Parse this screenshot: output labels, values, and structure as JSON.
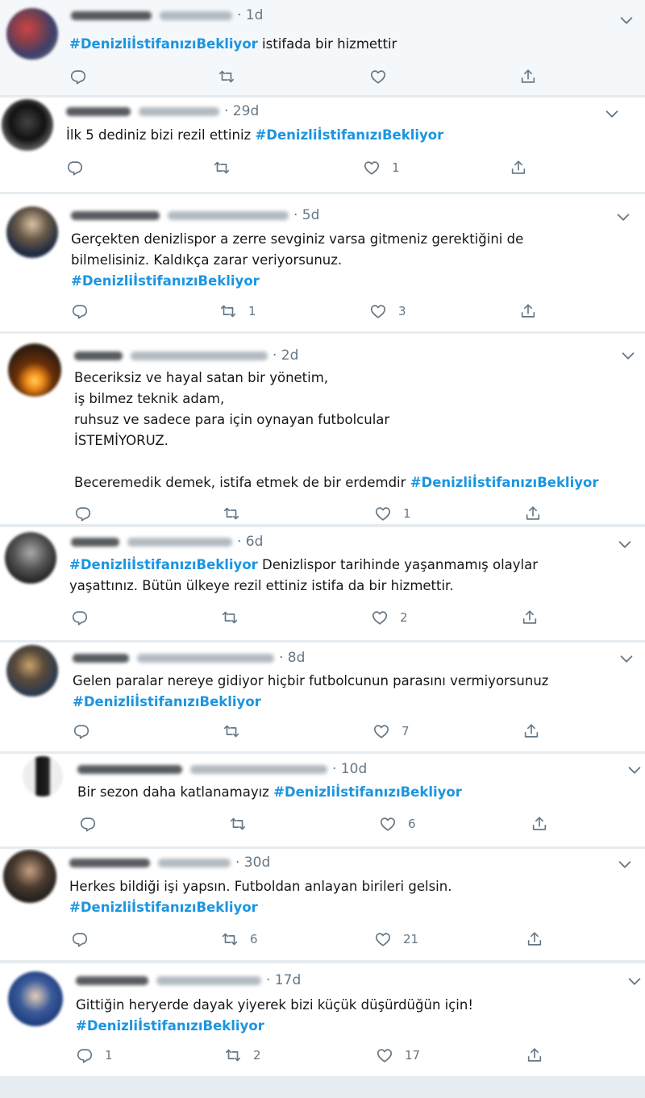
{
  "hashtag": "#DenizliİstifanızıBekliyor",
  "colors": {
    "link": "#1b95e0",
    "muted": "#657786",
    "text": "#14171a",
    "bg": "#e6ecf0"
  },
  "icons": {
    "reply": "reply-icon",
    "retweet": "retweet-icon",
    "like": "like-icon",
    "share": "share-icon",
    "menu": "chevron-down-icon"
  },
  "tweets": [
    {
      "time": "1d",
      "text_before": "",
      "text_after": " istifada bir hizmettir",
      "reply": "",
      "retweet": "",
      "like": ""
    },
    {
      "time": "29d",
      "text_before": "İlk 5 dediniz bizi rezil ettiniz ",
      "text_after": "",
      "reply": "",
      "retweet": "",
      "like": "1"
    },
    {
      "time": "5d",
      "text_before": "Gerçekten denizlispor a zerre sevginiz varsa  gitmeniz gerektiğini de\nbilmelisiniz. Kaldıkça zarar veriyorsunuz.\n",
      "text_after": "",
      "reply": "",
      "retweet": "1",
      "like": "3"
    },
    {
      "time": "2d",
      "text_before": "Beceriksiz ve hayal satan bir yönetim,\niş bilmez teknik adam,\nruhsuz ve sadece para için oynayan futbolcular\nİSTEMİYORUZ.\n\nBeceremedik demek, istifa etmek de bir erdemdir ",
      "text_after": "",
      "reply": "",
      "retweet": "",
      "like": "1"
    },
    {
      "time": "6d",
      "text_before": "",
      "text_after": " Denizlispor tarihinde yaşanmamış olaylar\nyaşattınız. Bütün ülkeye rezil ettiniz istifa da bir hizmettir.",
      "reply": "",
      "retweet": "",
      "like": "2"
    },
    {
      "time": "8d",
      "text_before": "Gelen paralar nereye gidiyor hiçbir futbolcunun parasını vermiyorsunuz\n",
      "text_after": "",
      "reply": "",
      "retweet": "",
      "like": "7"
    },
    {
      "time": "10d",
      "text_before": "Bir sezon daha katlanamayız ",
      "text_after": "",
      "reply": "",
      "retweet": "",
      "like": "6"
    },
    {
      "time": "30d",
      "text_before": "Herkes bildiği işi yapsın. Futboldan anlayan birileri gelsin.\n",
      "text_after": "",
      "reply": "",
      "retweet": "6",
      "like": "21"
    },
    {
      "time": "17d",
      "text_before": "Gittiğin heryerde dayak yiyerek bizi küçük düşürdüğün için!\n",
      "text_after": "",
      "reply": "1",
      "retweet": "2",
      "like": "17"
    }
  ]
}
